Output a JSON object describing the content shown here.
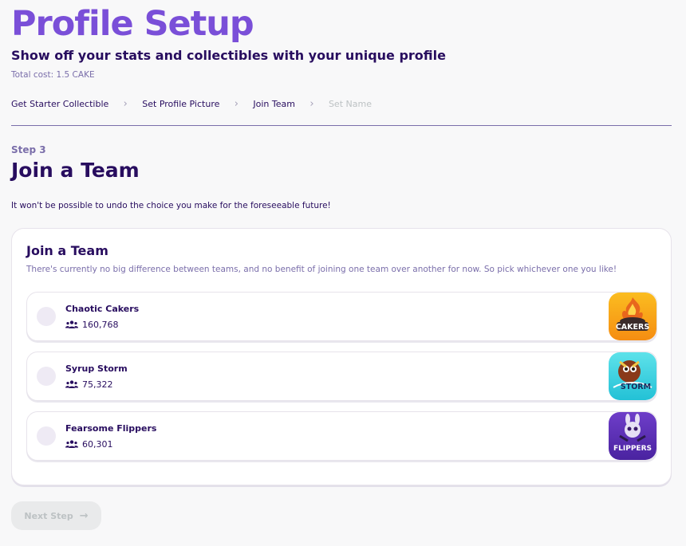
{
  "header": {
    "title": "Profile Setup",
    "subtitle": "Show off your stats and collectibles with your unique profile",
    "cost": "Total cost: 1.5 CAKE"
  },
  "breadcrumb": [
    {
      "label": "Get Starter Collectible",
      "state": "done"
    },
    {
      "label": "Set Profile Picture",
      "state": "done"
    },
    {
      "label": "Join Team",
      "state": "current"
    },
    {
      "label": "Set Name",
      "state": "disabled"
    }
  ],
  "step": {
    "label": "Step 3",
    "title": "Join a Team",
    "warning": "It won't be possible to undo the choice you make for the foreseeable future!"
  },
  "card": {
    "title": "Join a Team",
    "description": "There's currently no big difference between teams, and no benefit of joining one team over another for now. So pick whichever one you like!"
  },
  "teams": [
    {
      "name": "Chaotic Cakers",
      "members": "160,768",
      "image_text": "CAKERS",
      "color_top": "#fbbd20",
      "color_bottom": "#f58d12"
    },
    {
      "name": "Syrup Storm",
      "members": "75,322",
      "image_text": "STORM",
      "color_top": "#5ee2ea",
      "color_bottom": "#23c1d6"
    },
    {
      "name": "Fearsome Flippers",
      "members": "60,301",
      "image_text": "FLIPPERS",
      "color_top": "#6e3ec9",
      "color_bottom": "#4a23a0"
    }
  ],
  "footer": {
    "next_label": "Next Step"
  },
  "colors": {
    "brand": "#7a4fd8",
    "text": "#280d5f",
    "secondary": "#7a6eaa",
    "disabled": "#bdc2c4",
    "background": "#f8f8f9"
  }
}
